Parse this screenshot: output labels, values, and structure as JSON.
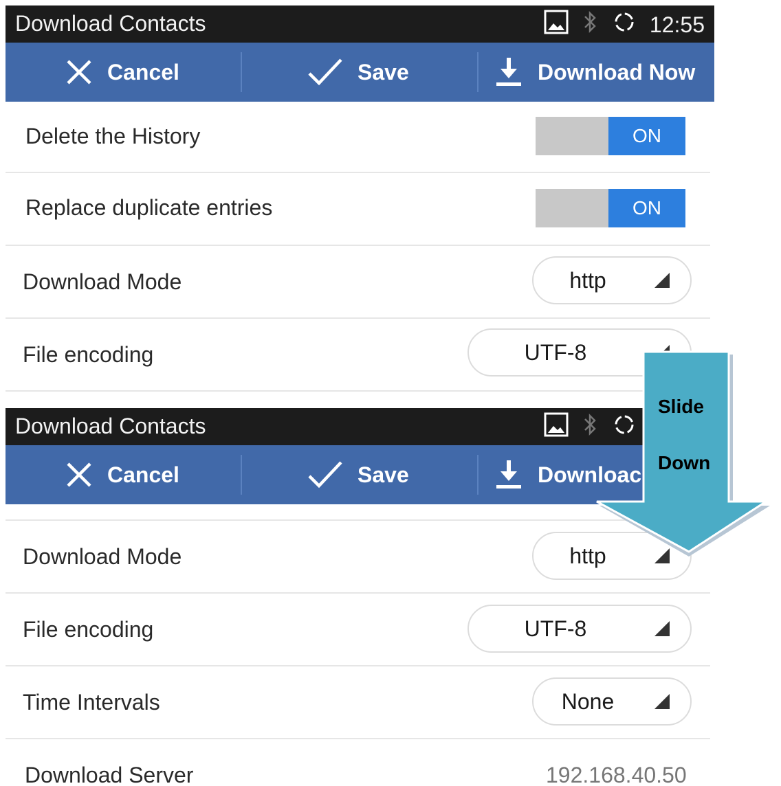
{
  "statusbar": {
    "title": "Download Contacts",
    "time": "12:55",
    "icons": [
      "picture-icon",
      "bluetooth-icon",
      "sync-icon"
    ]
  },
  "actionbar": {
    "cancel_label": "Cancel",
    "save_label": "Save",
    "download_label": "Download Now",
    "download_label_partial": "Downloac"
  },
  "top_screen": {
    "delete_history": {
      "label": "Delete the History",
      "state": "ON"
    },
    "replace_duplicates": {
      "label": "Replace duplicate entries",
      "state": "ON"
    },
    "download_mode": {
      "label": "Download Mode",
      "value": "http"
    },
    "file_encoding": {
      "label": "File encoding",
      "value": "UTF-8"
    }
  },
  "bottom_screen": {
    "download_mode": {
      "label": "Download Mode",
      "value": "http"
    },
    "file_encoding": {
      "label": "File encoding",
      "value": "UTF-8"
    },
    "time_intervals": {
      "label": "Time Intervals",
      "value": "None"
    },
    "download_server": {
      "label": "Download Server",
      "value": "192.168.40.50"
    }
  },
  "callout": {
    "line1": "Slide",
    "line2": "Down"
  },
  "colors": {
    "status_bar": "#1c1c1c",
    "action_bar": "#4169a9",
    "toggle_on": "#2d7fde",
    "callout_fill": "#4bacc6"
  }
}
